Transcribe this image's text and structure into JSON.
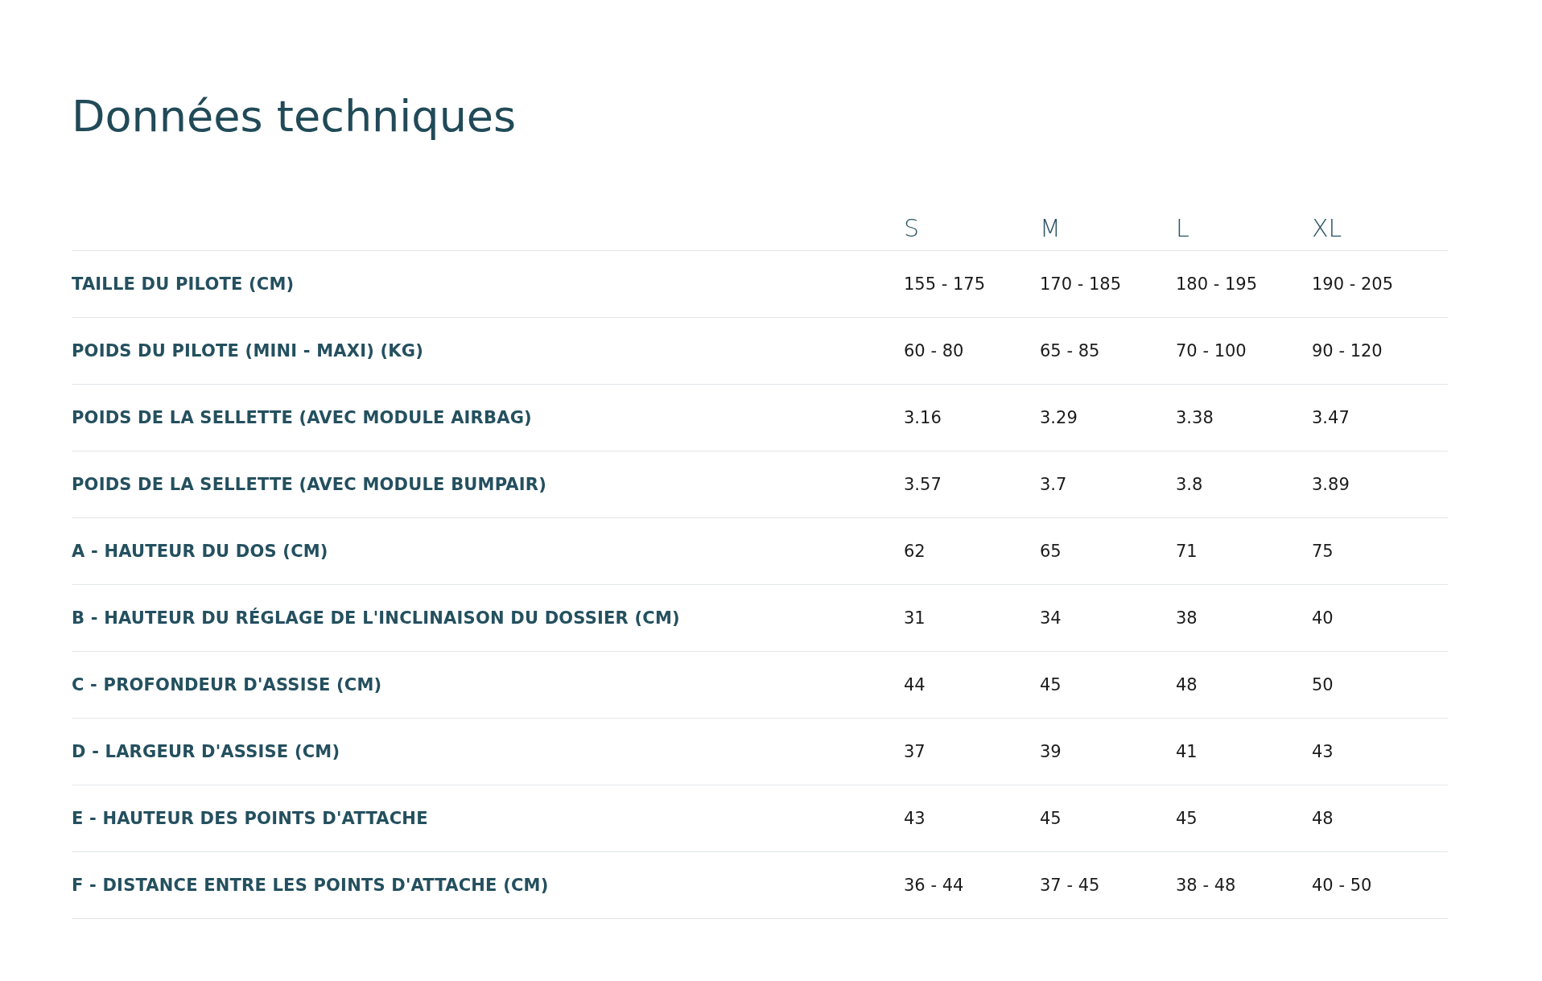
{
  "title": "Données techniques",
  "table": {
    "columns": [
      "S",
      "M",
      "L",
      "XL"
    ],
    "rows": [
      {
        "label": "TAILLE DU PILOTE (CM)",
        "values": [
          "155 - 175",
          "170 - 185",
          "180 - 195",
          "190 - 205"
        ]
      },
      {
        "label": "POIDS DU PILOTE (MINI - MAXI) (KG)",
        "values": [
          "60 - 80",
          "65 - 85",
          "70 - 100",
          "90 - 120"
        ]
      },
      {
        "label": "POIDS DE LA SELLETTE (AVEC MODULE AIRBAG)",
        "values": [
          "3.16",
          "3.29",
          "3.38",
          "3.47"
        ]
      },
      {
        "label": "POIDS DE LA SELLETTE (AVEC MODULE BUMPAIR)",
        "values": [
          "3.57",
          "3.7",
          "3.8",
          "3.89"
        ]
      },
      {
        "label": "A - HAUTEUR DU DOS (CM)",
        "values": [
          "62",
          "65",
          "71",
          "75"
        ]
      },
      {
        "label": "B - HAUTEUR DU RÉGLAGE DE L'INCLINAISON DU DOSSIER (CM)",
        "values": [
          "31",
          "34",
          "38",
          "40"
        ]
      },
      {
        "label": "C - PROFONDEUR D'ASSISE (CM)",
        "values": [
          "44",
          "45",
          "48",
          "50"
        ]
      },
      {
        "label": "D - LARGEUR D'ASSISE (CM)",
        "values": [
          "37",
          "39",
          "41",
          "43"
        ]
      },
      {
        "label": "E - HAUTEUR DES POINTS D'ATTACHE",
        "values": [
          "43",
          "45",
          "45",
          "48"
        ]
      },
      {
        "label": "F - DISTANCE ENTRE LES POINTS D'ATTACHE (CM)",
        "values": [
          "36 - 44",
          "37 - 45",
          "38 - 48",
          "40 - 50"
        ]
      }
    ]
  }
}
